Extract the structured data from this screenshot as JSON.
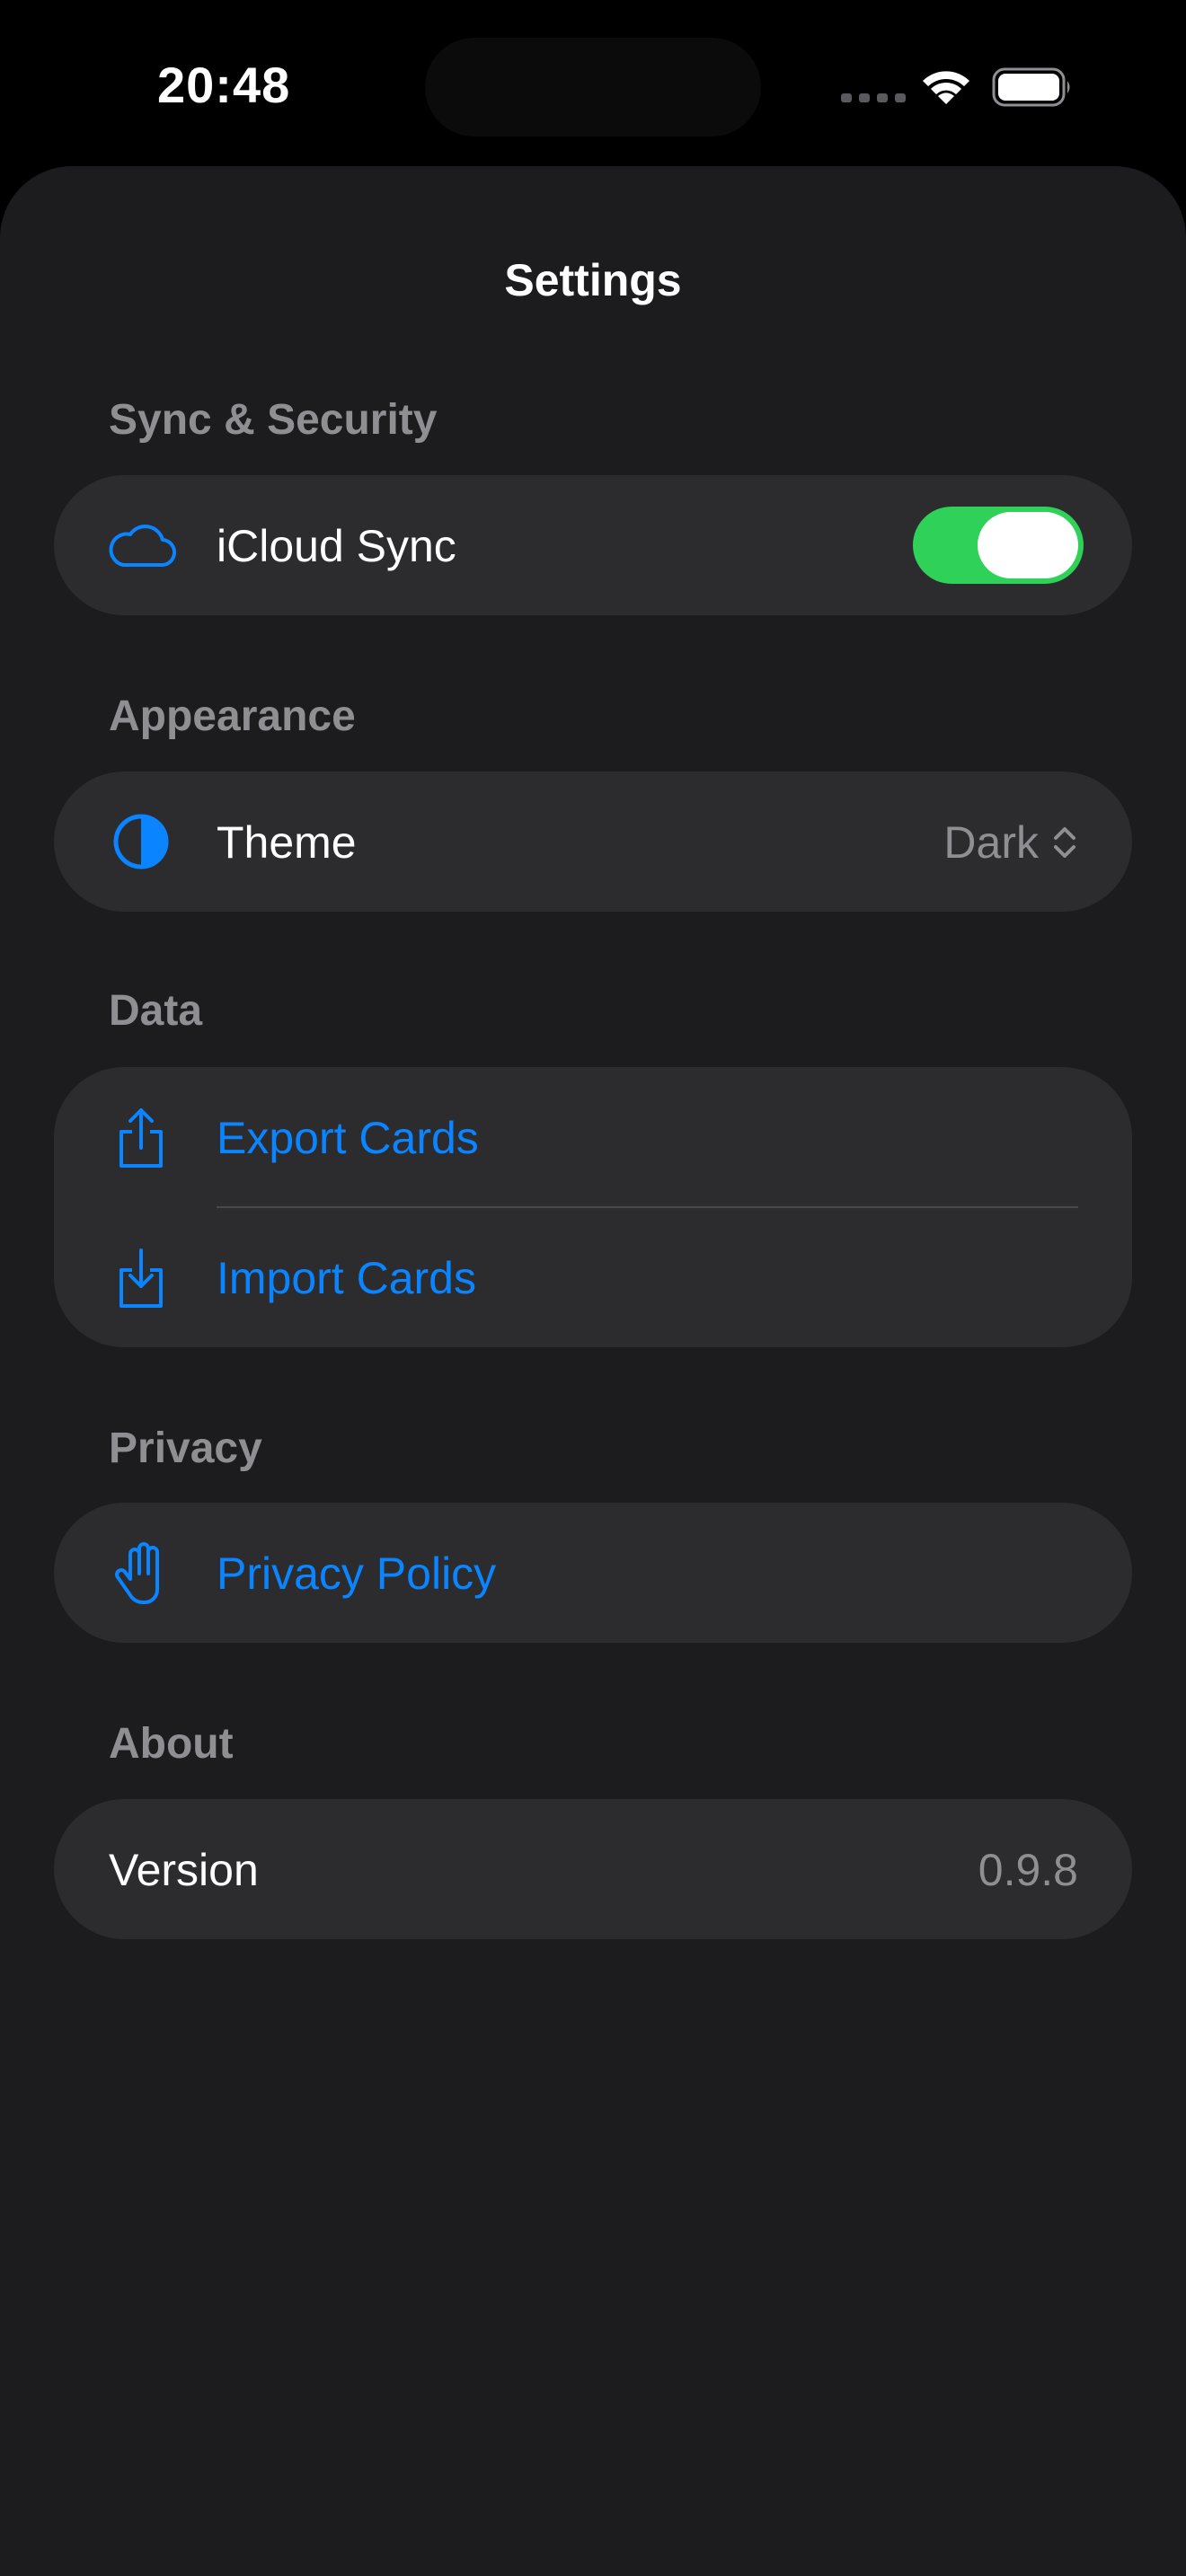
{
  "status_bar": {
    "time": "20:48"
  },
  "page": {
    "title": "Settings"
  },
  "sections": {
    "sync_security": {
      "header": "Sync & Security",
      "icloud_label": "iCloud Sync",
      "icloud_enabled": true
    },
    "appearance": {
      "header": "Appearance",
      "theme_label": "Theme",
      "theme_value": "Dark"
    },
    "data": {
      "header": "Data",
      "export_label": "Export Cards",
      "import_label": "Import Cards"
    },
    "privacy": {
      "header": "Privacy",
      "policy_label": "Privacy Policy"
    },
    "about": {
      "header": "About",
      "version_label": "Version",
      "version_value": "0.9.8"
    }
  },
  "colors": {
    "accent": "#0a84ff",
    "toggle_on": "#30d158",
    "background": "#1c1c1e",
    "cell": "#2c2c2e",
    "secondary_text": "#8e8e93"
  },
  "icons": {
    "icloud": "cloud-icon",
    "theme": "half-circle-contrast-icon",
    "export": "share-upload-icon",
    "import": "download-tray-icon",
    "privacy": "hand-raised-icon",
    "theme_picker": "chevron-up-down-icon"
  }
}
